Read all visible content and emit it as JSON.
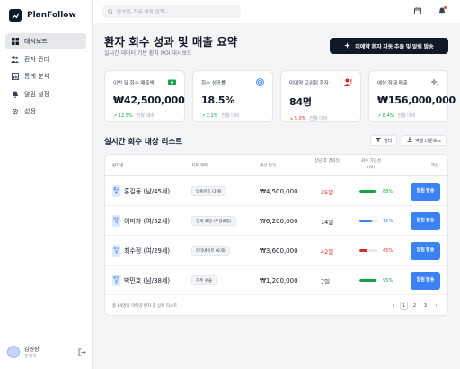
{
  "app": {
    "name": "PlanFollow"
  },
  "sidebar": {
    "items": [
      {
        "label": "대시보드",
        "icon": "dashboard-icon",
        "active": true
      },
      {
        "label": "환자 관리",
        "icon": "users-icon",
        "active": false
      },
      {
        "label": "통계 분석",
        "icon": "chart-icon",
        "active": false
      },
      {
        "label": "알림 설정",
        "icon": "bell-icon",
        "active": false
      },
      {
        "label": "설정",
        "icon": "gear-icon",
        "active": false
      }
    ],
    "user": {
      "name": "김원장",
      "role": "관리자"
    }
  },
  "search": {
    "placeholder": "환자명, 치료 계획 검색..."
  },
  "header": {
    "title": "환자 회수 성과 및 매출 요약",
    "subtitle": "실시간 데이터 기반 환자 ROI 대시보드",
    "action_label": "미예약 환자 자동 추출 및 알림 발송"
  },
  "stats": [
    {
      "label": "이번 달 회수 매출액",
      "value": "₩42,500,000",
      "delta": "12.5%",
      "delta_dir": "up",
      "compare": "전월 대비",
      "icon": "money-icon",
      "icon_color": "#16a34a"
    },
    {
      "label": "회수 성공률",
      "value": "18.5%",
      "delta": "2.1%",
      "delta_dir": "up",
      "compare": "전월 대비",
      "icon": "target-icon",
      "icon_color": "#3b82f6"
    },
    {
      "label": "미예약 고위험 환자",
      "value": "84명",
      "delta": "5.0%",
      "delta_dir": "down",
      "compare": "전월 대비",
      "icon": "user-alert-icon",
      "icon_color": "#dc2626"
    },
    {
      "label": "예상 잠재 매출",
      "value": "₩156,000,000",
      "delta": "8.4%",
      "delta_dir": "up",
      "compare": "전월 대비",
      "icon": "sparkle-icon",
      "icon_color": "#6b7280"
    }
  ],
  "list": {
    "title": "실시간 회수 대상 리스트",
    "filter_label": "필터",
    "export_label": "엑셀 다운로드",
    "columns": [
      "환자명",
      "치료 계획",
      "예상 단가",
      "상담 후 경과일",
      "회수 가능성 (AI)",
      "액션"
    ],
    "rows": [
      {
        "tag": "홍길동",
        "name": "홍길동 (남/45세)",
        "plan": "임플란트 (3개)",
        "price": "₩4,500,000",
        "days": "35일",
        "days_color": "#dc2626",
        "prob": 88,
        "prob_label": "88%",
        "bar_color": "#16a34a",
        "action": "알림 발송"
      },
      {
        "tag": "이미자",
        "name": "이미자 (여/52세)",
        "plan": "전체 교정 (투명교정)",
        "price": "₩6,200,000",
        "days": "14일",
        "days_color": "#111827",
        "prob": 72,
        "prob_label": "72%",
        "bar_color": "#3b82f6",
        "action": "알림 발송"
      },
      {
        "tag": "최수정",
        "name": "최수정 (여/29세)",
        "plan": "라미네이트 (6개)",
        "price": "₩3,600,000",
        "days": "42일",
        "days_color": "#dc2626",
        "prob": 45,
        "prob_label": "45%",
        "bar_color": "#dc2626",
        "action": "알림 발송"
      },
      {
        "tag": "박민호",
        "name": "박민호 (남/38세)",
        "plan": "치주 수술",
        "price": "₩1,200,000",
        "days": "7일",
        "days_color": "#111827",
        "prob": 95,
        "prob_label": "95%",
        "bar_color": "#16a34a",
        "action": "알림 발송"
      }
    ],
    "footer_note": "총 84명의 미예약 환자 중 상위 리스트",
    "pages": [
      "1",
      "2",
      "3"
    ],
    "current_page": "1"
  },
  "colors": {
    "accent": "#3b82f6",
    "dark": "#111827",
    "danger": "#dc2626",
    "success": "#16a34a"
  }
}
